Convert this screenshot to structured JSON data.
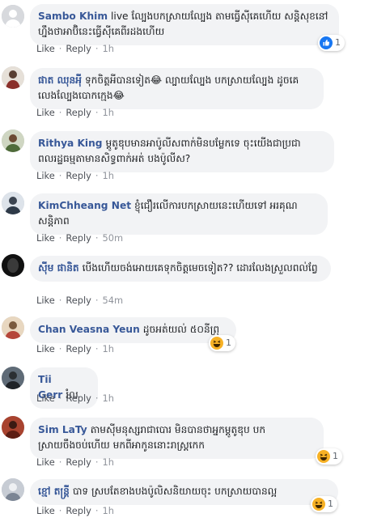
{
  "actions": {
    "like": "Like",
    "reply": "Reply",
    "separator": "·"
  },
  "comments": [
    {
      "name": "Sambo Khim",
      "text": "live ល្បែងបកស្រាយល្បែង តាមធ្វើស៊ីគេហើយ សន្តិសុខនៅហ្នឹងថាអាប៊ិនេះធ្វើស៊ីគេពីរដងហើយ",
      "time": "1h",
      "reaction": {
        "type": "like-icon",
        "count": "1",
        "color": "#1877f2"
      },
      "avatar_color": "#d7d9dd"
    },
    {
      "name": "ផាត ឈុនអុី",
      "text": "ទុកចិត្តអីបានទៀត😂 ល្បាយល្បែង បកស្រាយល្បែង ដូចគេលេងល្បែងបោកក្មេង😂",
      "time": "1h",
      "reaction": null,
      "avatar_color": "#8a6a5c"
    },
    {
      "name": "Rithya King",
      "text": "ម្តូតូឌុបមានអាប៉ូលីសពាក់មិនបម្លែកទេ ចុះយើងជាប្រជាពលរដ្ឋធម្មតាមានសិទ្ធពាក់អត់ បងប៉ូលីស?",
      "time": "1h",
      "reaction": null,
      "avatar_color": "#7d8a5e"
    },
    {
      "name": "KimChheang Net",
      "text": "ខ្ញុំជឿរលើការបកស្រាយនេះហើយទៅ អរគុណសន្តិភាព",
      "time": "50m",
      "reaction": null,
      "avatar_color": "#6a7f96"
    },
    {
      "name": "ស៊ីម ផានិត",
      "text": "បើងហើយចង់អោយគេទុកចិត្តមេចទៀត?? ដោរលែងស្រួលពល់ព្វែ",
      "time": "54m",
      "reaction": null,
      "avatar_color": "#1e1e1e"
    },
    {
      "name": "Chan Veasna Yeun",
      "text": "ដូចអត់យល់ ៥០នីព្រុ",
      "time": "1h",
      "reaction": {
        "type": "haha-icon",
        "count": "1",
        "color": "#f7b125"
      },
      "avatar_color": "#b08860"
    },
    {
      "name": "Tii Gerr",
      "text": "រំល",
      "time": "1h",
      "reaction": null,
      "avatar_color": "#4e5a66"
    },
    {
      "name": "Sim LaTy",
      "text": "តាមស៊ីមនុស្សរាជាបោរ មិនបានថាអ្នកម្តូតូឌុប បកស្រាយចឹងចប់ហើយ មកពីអាកូននោះរាស្ត្រកេក",
      "time": "1h",
      "reaction": {
        "type": "haha-icon",
        "count": "1",
        "color": "#f7b125"
      },
      "avatar_color": "#8c3b2c"
    },
    {
      "name": "ខ្មៅ តន្រ្តី",
      "text": "បាទ ស្របតែខាងបងប៉ូលិសនិយាយចុះ បកស្រាយបានល្អ",
      "time": "1h",
      "reaction": {
        "type": "haha-icon",
        "count": "1",
        "color": "#f7b125"
      },
      "avatar_color": "#9aa3b0"
    }
  ]
}
